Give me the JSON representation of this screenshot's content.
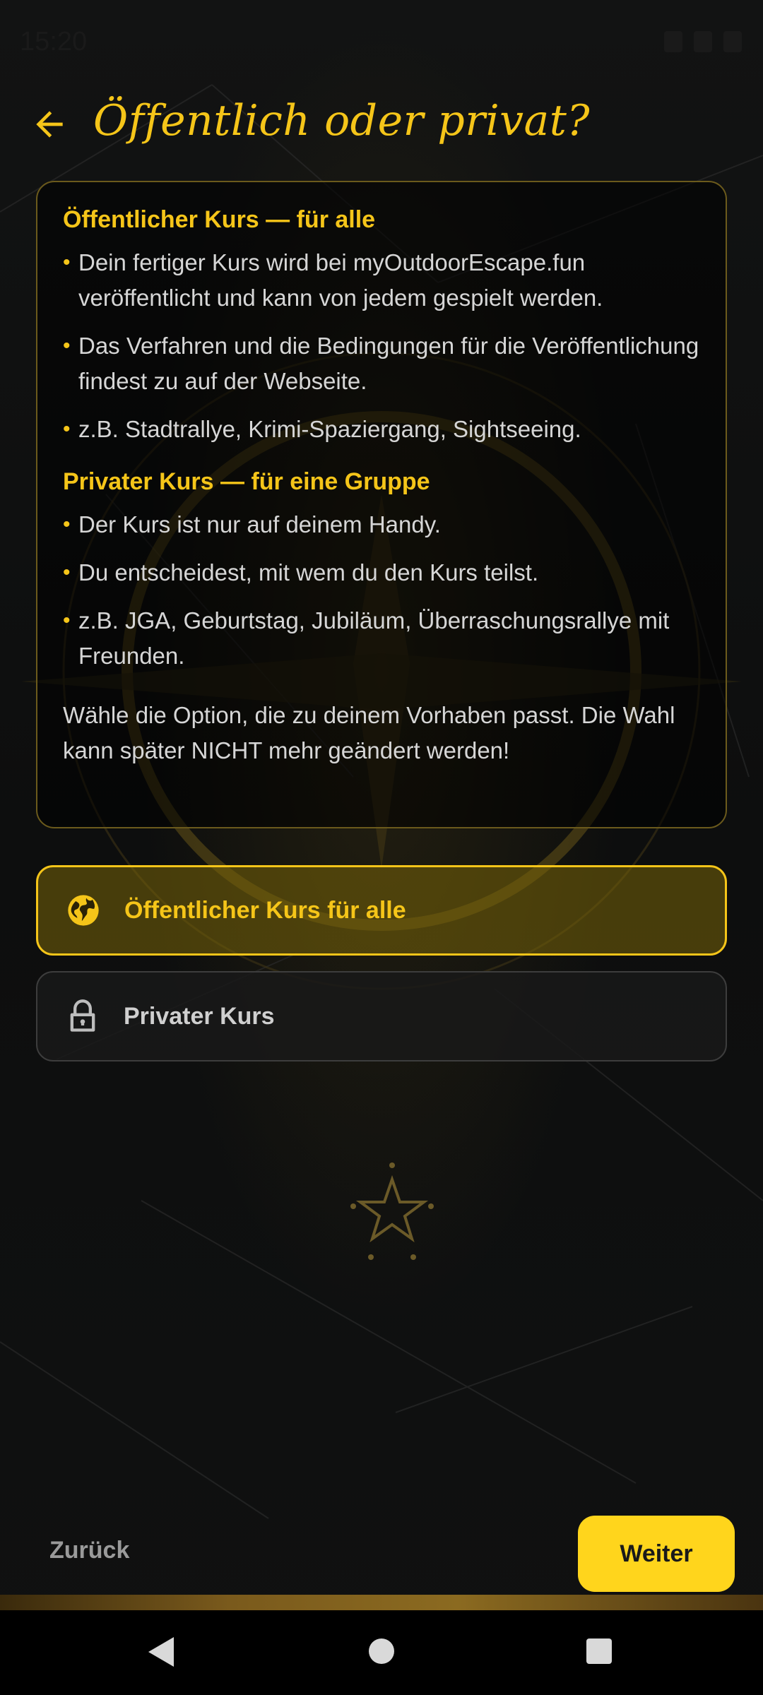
{
  "status_bar": {
    "time": "15:20"
  },
  "header": {
    "title": "Öffentlich oder privat?"
  },
  "info": {
    "public_title": "Öffentlicher Kurs — für alle",
    "public_bullets": [
      "Dein fertiger Kurs wird bei myOutdoorEscape.fun veröffentlicht und kann von jedem gespielt werden.",
      "Das Verfahren und die Bedingungen für die Veröffentlichung findest zu auf der Webseite.",
      "z.B. Stadtrallye, Krimi-Spaziergang, Sightseeing."
    ],
    "private_title": "Privater Kurs — für eine Gruppe",
    "private_bullets": [
      "Der Kurs ist nur auf deinem Handy.",
      "Du entscheidest, mit wem du den Kurs teilst.",
      "z.B. JGA, Geburtstag, Jubiläum, Überraschungsrallye mit Freunden."
    ],
    "note": "Wähle die Option, die zu deinem Vorhaben passt. Die Wahl kann später NICHT mehr geändert werden!"
  },
  "options": [
    {
      "label": "Öffentlicher Kurs für alle",
      "icon": "globe-icon",
      "selected": true
    },
    {
      "label": "Privater Kurs",
      "icon": "lock-icon",
      "selected": false
    }
  ],
  "footer": {
    "back_label": "Zurück",
    "next_label": "Weiter"
  },
  "colors": {
    "accent": "#f5c519",
    "button": "#ffd51c",
    "background": "#0b0c0c"
  }
}
